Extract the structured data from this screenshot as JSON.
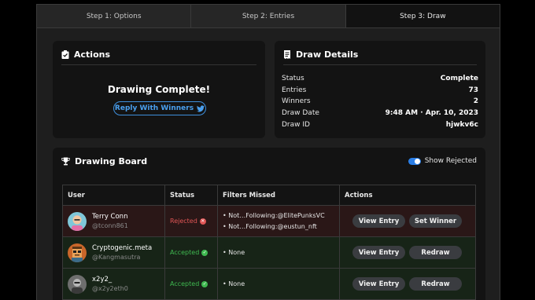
{
  "tabs": [
    "Step 1: Options",
    "Step 2: Entries",
    "Step 3: Draw"
  ],
  "actions": {
    "title": "Actions",
    "status_text": "Drawing Complete!",
    "reply_label": "Reply With Winners"
  },
  "details": {
    "title": "Draw Details",
    "rows": [
      {
        "label": "Status",
        "value": "Complete"
      },
      {
        "label": "Entries",
        "value": "73"
      },
      {
        "label": "Winners",
        "value": "2"
      },
      {
        "label": "Draw Date",
        "value": "9:48 AM · Apr. 10, 2023"
      },
      {
        "label": "Draw ID",
        "value": "hjwkv6c"
      }
    ]
  },
  "board": {
    "title": "Drawing Board",
    "toggle_label": "Show Rejected",
    "toggle_on": true,
    "columns": [
      "User",
      "Status",
      "Filters Missed",
      "Actions"
    ],
    "rows": [
      {
        "name": "Terry Conn",
        "handle": "@tconn861",
        "status": "Rejected",
        "filters": [
          "• Not…Following:@ElitePunksVC",
          "• Not…Following:@eustun_nft"
        ],
        "actions": [
          "View Entry",
          "Set Winner"
        ]
      },
      {
        "name": "Cryptogenic.meta",
        "handle": "@Kangmasutra",
        "status": "Accepted",
        "filters": [
          "• None"
        ],
        "actions": [
          "View Entry",
          "Redraw"
        ]
      },
      {
        "name": "x2y2_",
        "handle": "@x2y2eth0",
        "status": "Accepted",
        "filters": [
          "• None"
        ],
        "actions": [
          "View Entry",
          "Redraw"
        ]
      }
    ]
  },
  "colors": {
    "accent_blue": "#3e8fdc",
    "rejected": "#e05555",
    "accepted": "#3fb950"
  }
}
